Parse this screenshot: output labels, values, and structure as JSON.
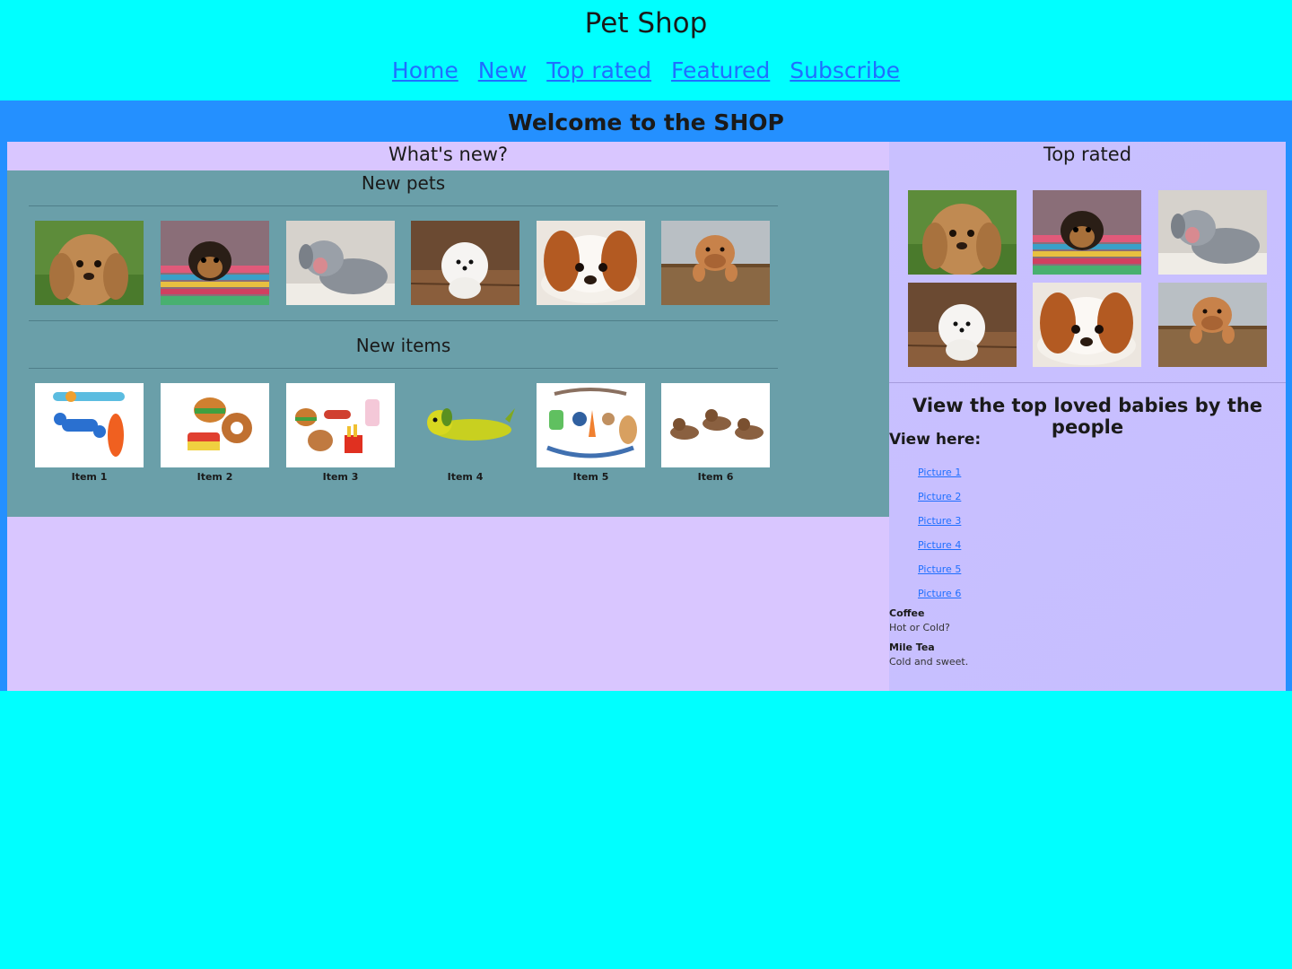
{
  "header": {
    "title": "Pet Shop",
    "nav": [
      "Home",
      "New",
      "Top rated",
      "Featured",
      "Subscribe"
    ]
  },
  "welcome": "Welcome to the SHOP",
  "whats_new": {
    "heading": "What's new?",
    "new_pets": {
      "heading": "New pets",
      "pets": [
        "cocker-spaniel-puppy",
        "yorkie-puppy-on-rug",
        "grey-puppy-yawning",
        "white-pomeranian",
        "cavalier-puppy-lying",
        "mastiff-puppy-in-box"
      ]
    },
    "new_items": {
      "heading": "New items",
      "items": [
        "Item 1",
        "Item 2",
        "Item 3",
        "Item 4",
        "Item 5",
        "Item 6"
      ]
    }
  },
  "top_rated": {
    "heading": "Top rated",
    "pets": [
      "cocker-spaniel-puppy",
      "yorkie-puppy-on-rug",
      "grey-puppy-yawning",
      "white-pomeranian",
      "cavalier-puppy-lying",
      "mastiff-puppy-in-box"
    ],
    "loved_heading": "View the top loved babies by the people",
    "view_here": "View here:",
    "pictures": [
      "Picture 1",
      "Picture 2",
      "Picture 3",
      "Picture 4",
      "Picture 5",
      "Picture 6"
    ],
    "drinks": [
      {
        "term": "Coffee",
        "desc": "Hot or Cold?"
      },
      {
        "term": "Mile Tea",
        "desc": "Cold and sweet."
      }
    ]
  },
  "colors": {
    "page_bg": "#00ffff",
    "frame_bg": "#2490ff",
    "left_bg": "#d9c6ff",
    "teal_box": "#6a9fa9",
    "right_bg": "#c9c0ff",
    "link": "#1f6fff"
  }
}
